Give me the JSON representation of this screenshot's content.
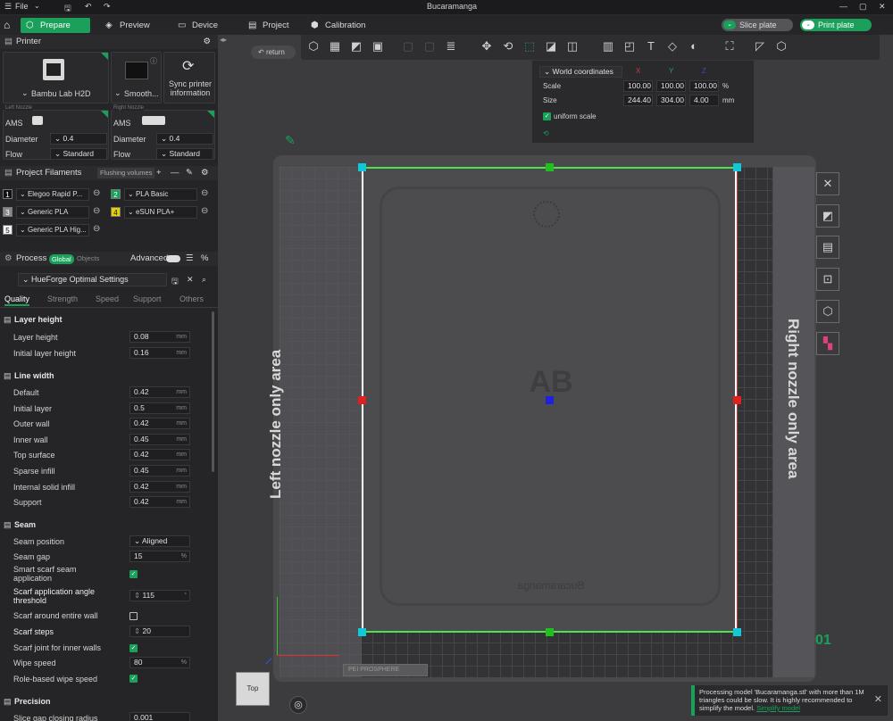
{
  "titlebar": {
    "menu_label": "File",
    "window_title": "Bucaramanga"
  },
  "tabs": {
    "prepare": "Prepare",
    "preview": "Preview",
    "device": "Device",
    "project": "Project",
    "calibration": "Calibration"
  },
  "actions": {
    "slice": "Slice plate",
    "print": "Print plate"
  },
  "printer": {
    "header": "Printer",
    "name": "Bambu Lab H2D",
    "plate": "Smooth...",
    "sync_label": "Sync printer information",
    "left": {
      "nozzle_label": "Left Nozzle",
      "ams": "AMS",
      "diameter_label": "Diameter",
      "diameter": "0.4",
      "flow_label": "Flow",
      "flow": "Standard"
    },
    "right": {
      "nozzle_label": "Right Nozzle",
      "ams": "AMS",
      "diameter_label": "Diameter",
      "diameter": "0.4",
      "flow_label": "Flow",
      "flow": "Standard"
    }
  },
  "filaments": {
    "header": "Project Filaments",
    "flushing": "Flushing volumes",
    "items": [
      {
        "num": "1",
        "name": "Elegoo Rapid P...",
        "color": "#111111"
      },
      {
        "num": "2",
        "name": "PLA Basic",
        "color": "#1aa05a"
      },
      {
        "num": "3",
        "name": "Generic PLA",
        "color": "#888888"
      },
      {
        "num": "4",
        "name": "eSUN PLA+",
        "color": "#e6d000"
      },
      {
        "num": "5",
        "name": "Generic PLA Hig...",
        "color": "#f2f2f2"
      }
    ]
  },
  "process": {
    "header": "Process",
    "global": "Global",
    "objects": "Objects",
    "advanced": "Advanced",
    "preset": "HueForge Optimal Settings",
    "tabs": [
      "Quality",
      "Strength",
      "Speed",
      "Support",
      "Others"
    ]
  },
  "settings": {
    "layer_height": {
      "title": "Layer height",
      "rows": [
        {
          "label": "Layer height",
          "value": "0.08",
          "unit": "mm"
        },
        {
          "label": "Initial layer height",
          "value": "0.16",
          "unit": "mm"
        }
      ]
    },
    "line_width": {
      "title": "Line width",
      "rows": [
        {
          "label": "Default",
          "value": "0.42",
          "unit": "mm"
        },
        {
          "label": "Initial layer",
          "value": "0.5",
          "unit": "mm"
        },
        {
          "label": "Outer wall",
          "value": "0.42",
          "unit": "mm"
        },
        {
          "label": "Inner wall",
          "value": "0.45",
          "unit": "mm"
        },
        {
          "label": "Top surface",
          "value": "0.42",
          "unit": "mm"
        },
        {
          "label": "Sparse infill",
          "value": "0.45",
          "unit": "mm"
        },
        {
          "label": "Internal solid infill",
          "value": "0.42",
          "unit": "mm"
        },
        {
          "label": "Support",
          "value": "0.42",
          "unit": "mm"
        }
      ]
    },
    "seam": {
      "title": "Seam",
      "seam_position_label": "Seam position",
      "seam_position": "Aligned",
      "seam_gap_label": "Seam gap",
      "seam_gap": "15",
      "seam_gap_unit": "%",
      "smart_scarf_label": "Smart scarf seam application",
      "scarf_angle_label": "Scarf application angle threshold",
      "scarf_angle": "115",
      "scarf_angle_unit": "°",
      "scarf_entire_label": "Scarf around entire wall",
      "scarf_steps_label": "Scarf steps",
      "scarf_steps": "20",
      "scarf_inner_label": "Scarf joint for inner walls",
      "wipe_speed_label": "Wipe speed",
      "wipe_speed": "80",
      "wipe_speed_unit": "%",
      "role_wipe_label": "Role-based wipe speed"
    },
    "precision": {
      "title": "Precision",
      "slice_gap_label": "Slice gap closing radius",
      "slice_gap": "0.001"
    }
  },
  "viewport": {
    "return_label": "return",
    "coords": {
      "mode": "World coordinates",
      "x": "X",
      "y": "Y",
      "z": "Z",
      "scale_label": "Scale",
      "scale_x": "100.00",
      "scale_y": "100.00",
      "scale_z": "100.00",
      "scale_unit": "%",
      "size_label": "Size",
      "size_x": "244.40",
      "size_y": "304.00",
      "size_z": "4.00",
      "size_unit": "mm",
      "uniform_label": "uniform scale"
    },
    "left_area": "Left nozzle only area",
    "right_area": "Right nozzle only area",
    "plate_number": "01",
    "view_label": "Top",
    "plate_text": "PEI PROSPHERE",
    "model_text": "AB",
    "model_caption": "Bucaramanga"
  },
  "notification": {
    "text": "Processing model 'Bucaramanga.stl' with more than 1M triangles could be slow. It is highly recommended to simplify the model.",
    "link": "Simplify model"
  }
}
